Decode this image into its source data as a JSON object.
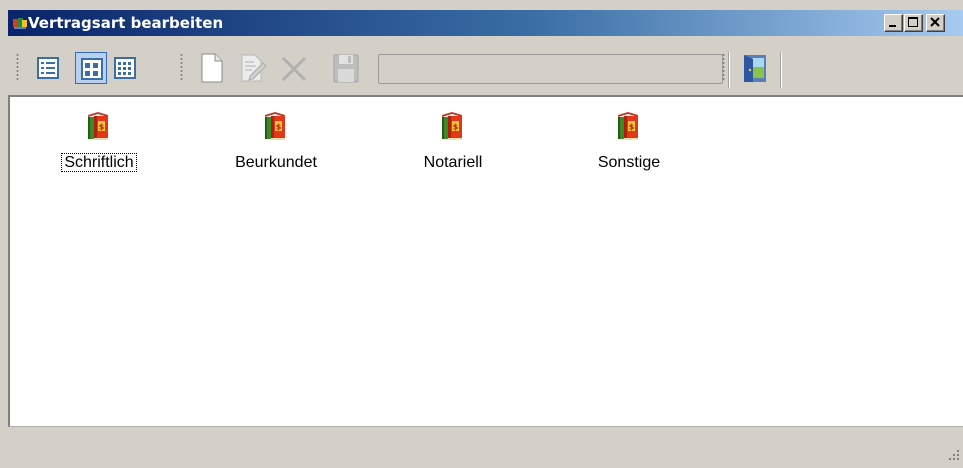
{
  "window": {
    "title": "Vertragsart bearbeiten",
    "controls": [
      "minimize",
      "maximize",
      "close"
    ]
  },
  "toolbar": {
    "buttons": [
      {
        "name": "details-view",
        "icon": "details-view-icon",
        "state": "normal"
      },
      {
        "name": "large-icons-view",
        "icon": "large-icons-view-icon",
        "state": "pressed"
      },
      {
        "name": "small-icons-view",
        "icon": "small-icons-view-icon",
        "state": "normal"
      },
      {
        "name": "new",
        "icon": "new-document-icon",
        "state": "enabled"
      },
      {
        "name": "edit",
        "icon": "edit-icon",
        "state": "disabled"
      },
      {
        "name": "delete",
        "icon": "delete-icon",
        "state": "disabled"
      },
      {
        "name": "save",
        "icon": "save-icon",
        "state": "disabled"
      },
      {
        "name": "exit",
        "icon": "exit-door-icon",
        "state": "enabled"
      }
    ],
    "text_field": {
      "value": "",
      "state": "disabled"
    }
  },
  "items": [
    {
      "label": "Schriftlich",
      "icon": "contract-book-icon",
      "focused": true
    },
    {
      "label": "Beurkundet",
      "icon": "contract-book-icon",
      "focused": false
    },
    {
      "label": "Notariell",
      "icon": "contract-book-icon",
      "focused": false
    },
    {
      "label": "Sonstige",
      "icon": "contract-book-icon",
      "focused": false
    }
  ],
  "colors": {
    "titlebar_start": "#0a246a",
    "titlebar_end": "#a6caf0",
    "face": "#d4d0c8",
    "accent": "#316ac5"
  }
}
